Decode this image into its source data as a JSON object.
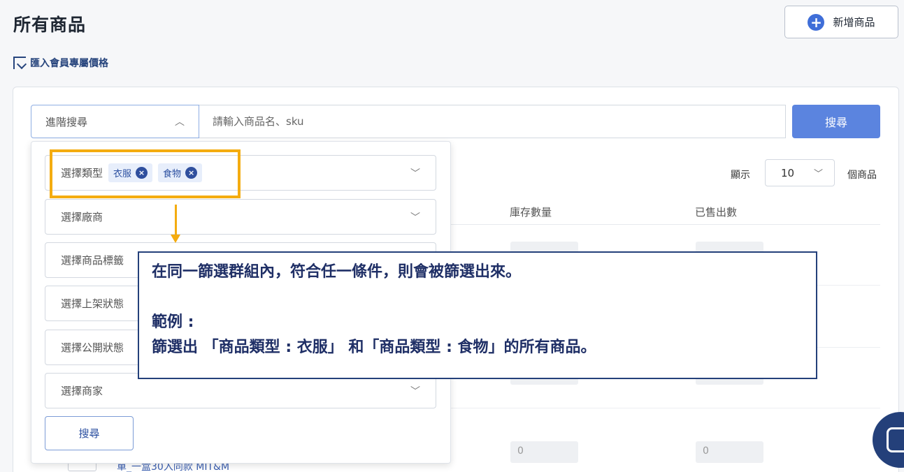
{
  "page": {
    "title": "所有商品",
    "add_button": "新增商品",
    "import_link": "匯入會員專屬價格"
  },
  "search": {
    "advanced_label": "進階搜尋",
    "placeholder": "請輸入商品名、sku",
    "button": "搜尋"
  },
  "list_controls": {
    "show_label": "顯示",
    "page_size": "10",
    "unit_label": "個商品"
  },
  "table": {
    "columns": [
      "庫存數量",
      "已售出數"
    ],
    "visible_values": [
      "0",
      "0"
    ],
    "partial_product_name": "單_一盒30入同款 MIT&M"
  },
  "filters": {
    "type": {
      "label": "選擇類型",
      "chips": [
        "衣服",
        "食物"
      ]
    },
    "vendor": "選擇廠商",
    "tag": "選擇商品標籤",
    "shelf_status": "選擇上架狀態",
    "public_status": "選擇公開狀態",
    "merchant": "選擇商家",
    "search_button": "搜尋"
  },
  "callout": {
    "line1": "在同一篩選群組內，符合任一條件，則會被篩選出來。",
    "line2": "範例 :",
    "line3": "篩選出 「商品類型 : 衣服」 和「商品類型 : 食物」的所有商品。"
  },
  "colors": {
    "primary": "#5b84df",
    "dark_blue": "#24407a",
    "highlight": "#f4ac10"
  }
}
